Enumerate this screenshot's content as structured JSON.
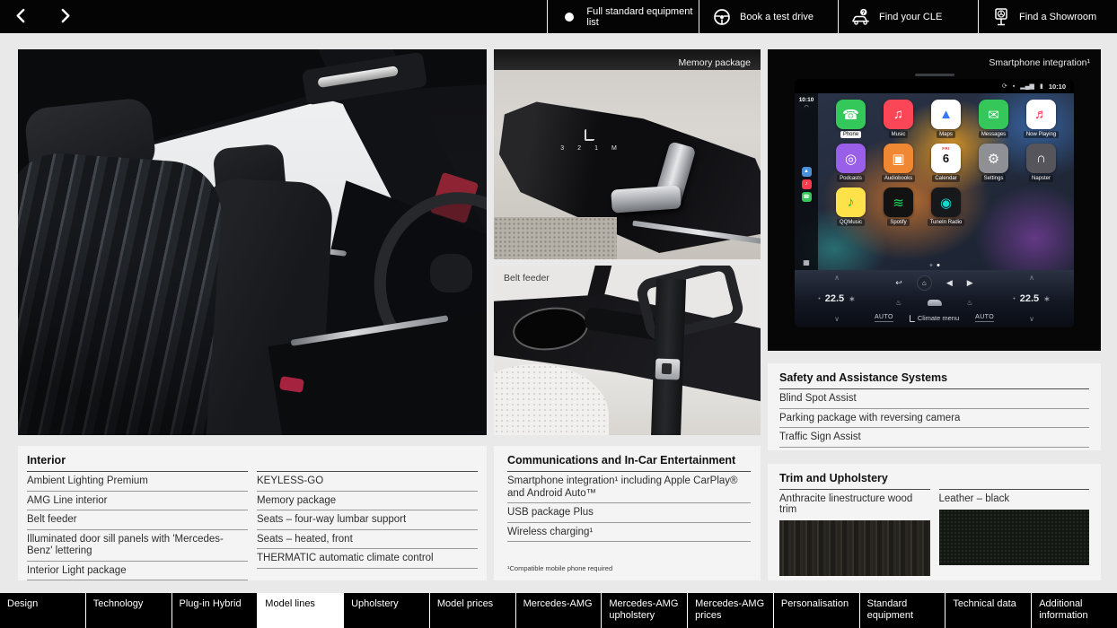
{
  "top_bar": {
    "buttons": [
      {
        "label": "Full standard equipment list",
        "icon": "bullet-circle-icon"
      },
      {
        "label": "Book a test drive",
        "icon": "steering-wheel-icon"
      },
      {
        "label": "Find your CLE",
        "icon": "car-question-icon"
      },
      {
        "label": "Find a Showroom",
        "icon": "showroom-sign-icon"
      }
    ]
  },
  "photos": {
    "memory": {
      "label": "Memory package",
      "memory_buttons": [
        "3",
        "2",
        "1",
        "M"
      ]
    },
    "belt": {
      "label": "Belt feeder"
    },
    "mbux": {
      "label": "Smartphone integration¹"
    }
  },
  "mbux_screen": {
    "status_time": "10:10",
    "sidebar_time": "10:10",
    "app_rows": [
      [
        {
          "name": "Phone",
          "glyph": "☎",
          "bg": "#34c759",
          "fg": "#ffffff",
          "label_active": true
        },
        {
          "name": "Music",
          "glyph": "♫",
          "bg": "#fa4656",
          "fg": "#ffffff"
        },
        {
          "name": "Maps",
          "glyph": "▲",
          "bg": "#ffffff",
          "fg": "#3478f6"
        },
        {
          "name": "Messages",
          "glyph": "✉",
          "bg": "#35c759",
          "fg": "#ffffff"
        },
        {
          "name": "Now Playing",
          "glyph": "♬",
          "bg": "#ffffff",
          "fg": "#fa2f48"
        }
      ],
      [
        {
          "name": "Podcasts",
          "glyph": "◎",
          "bg": "#9a5fe8",
          "fg": "#ffffff"
        },
        {
          "name": "Audiobooks",
          "glyph": "▣",
          "bg": "#ef8733",
          "fg": "#ffffff"
        },
        {
          "name": "Calendar",
          "glyph": "6",
          "bg": "#ffffff",
          "fg": "#111111",
          "sub": "FRI"
        },
        {
          "name": "Settings",
          "glyph": "⚙",
          "bg": "#8e9095",
          "fg": "#ffffff"
        },
        {
          "name": "Napster",
          "glyph": "∩",
          "bg": "#55555b",
          "fg": "#ffffff"
        }
      ],
      [
        {
          "name": "QQMusic",
          "glyph": "♪",
          "bg": "#ffe14a",
          "fg": "#21b24a"
        },
        {
          "name": "Spotify",
          "glyph": "≋",
          "bg": "#121212",
          "fg": "#1ed760"
        },
        {
          "name": "TuneIn Radio",
          "glyph": "◉",
          "bg": "#16181c",
          "fg": "#14d8cc"
        }
      ]
    ],
    "climate": {
      "left_temp": "22.5",
      "right_temp": "22.5",
      "auto_left": "AUTO",
      "auto_right": "AUTO",
      "menu": "Climate menu"
    }
  },
  "sections": {
    "interior": {
      "title": "Interior",
      "col1": [
        "Ambient Lighting Premium",
        "AMG Line interior",
        "Belt feeder",
        "Illuminated door sill panels with 'Mercedes-Benz' lettering",
        "Interior Light package"
      ],
      "col2": [
        "KEYLESS-GO",
        "Memory package",
        "Seats – four-way lumbar support",
        "Seats – heated, front",
        "THERMATIC automatic climate control"
      ]
    },
    "comms": {
      "title": "Communications and In-Car Entertainment",
      "items": [
        "Smartphone integration¹ including Apple CarPlay® and Android Auto™",
        "USB package Plus",
        "Wireless charging¹"
      ],
      "footnote": "¹Compatible mobile phone required"
    },
    "safety": {
      "title": "Safety and Assistance Systems",
      "items": [
        "Blind Spot Assist",
        "Parking package with reversing camera",
        "Traffic Sign Assist"
      ]
    },
    "trim": {
      "title": "Trim and Upholstery",
      "swatch1_label": "Anthracite linestructure wood trim",
      "swatch2_label": "Leather – black"
    }
  },
  "tabs": [
    {
      "label": "Design"
    },
    {
      "label": "Technology"
    },
    {
      "label": "Plug-in Hybrid"
    },
    {
      "label": "Model lines",
      "active": true
    },
    {
      "label": "Upholstery"
    },
    {
      "label": "Model prices"
    },
    {
      "label": "Mercedes-AMG"
    },
    {
      "label": "Mercedes-AMG upholstery"
    },
    {
      "label": "Mercedes-AMG prices"
    },
    {
      "label": "Personalisation"
    },
    {
      "label": "Standard equipment"
    },
    {
      "label": "Technical data"
    },
    {
      "label": "Additional information"
    }
  ]
}
